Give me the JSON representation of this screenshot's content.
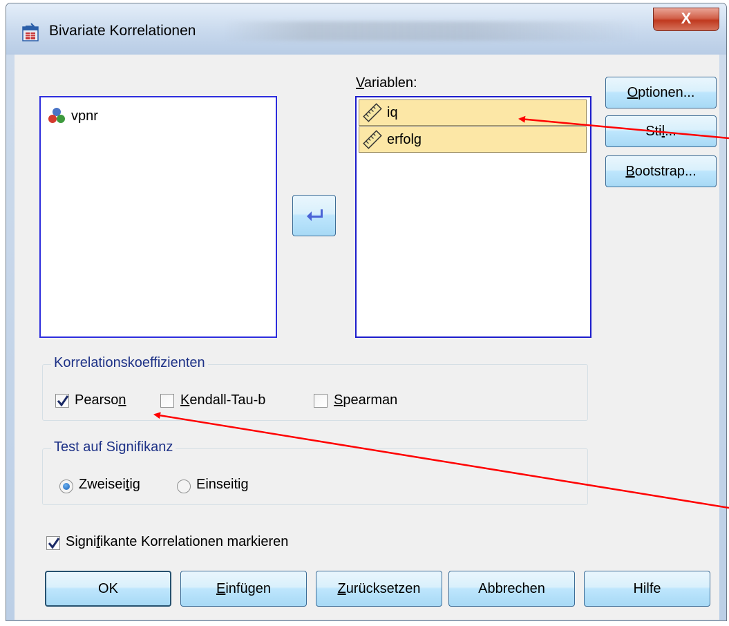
{
  "window": {
    "title": "Bivariate Korrelationen",
    "close_glyph": "X"
  },
  "source_list": {
    "items": [
      {
        "label": "vpnr",
        "icon": "nominal-variable-icon"
      }
    ]
  },
  "target_list": {
    "label_prefix": "",
    "label_underline": "V",
    "label_rest": "ariablen:",
    "items": [
      {
        "label": "iq",
        "icon": "scale-variable-icon"
      },
      {
        "label": "erfolg",
        "icon": "scale-variable-icon"
      }
    ]
  },
  "side_buttons": {
    "optionen": {
      "u": "O",
      "rest": "ptionen..."
    },
    "stil": {
      "pre": "Sti",
      "u": "l",
      "rest": "..."
    },
    "bootstrap": {
      "u": "B",
      "rest": "ootstrap..."
    }
  },
  "move_button_icon": "arrow-back-icon",
  "koeffizienten": {
    "title": "Korrelationskoeffizienten",
    "pearson": {
      "pre": "Pearso",
      "u": "n",
      "checked": true
    },
    "kendall": {
      "u": "K",
      "rest": "endall-Tau-b",
      "checked": false
    },
    "spearman": {
      "u": "S",
      "rest": "pearman",
      "checked": false
    }
  },
  "signifikanz": {
    "title": "Test auf Signifikanz",
    "zweiseitig": {
      "pre": "Zweisei",
      "u": "t",
      "rest": "ig",
      "selected": true
    },
    "einseitig": {
      "label": "Einseitig",
      "selected": false
    }
  },
  "markieren": {
    "pre": "Signi",
    "u": "f",
    "rest": "ikante Korrelationen markieren",
    "checked": true
  },
  "bottom_buttons": {
    "ok": "OK",
    "einfuegen": {
      "u": "E",
      "rest": "infügen"
    },
    "zuruecksetzen": {
      "u": "Z",
      "rest": "urücksetzen"
    },
    "abbrechen": "Abbrechen",
    "hilfe": "Hilfe"
  },
  "colors": {
    "annotation_arrow": "#ff0000",
    "accent": "#2d2ddd",
    "group_title": "#1e3287"
  }
}
